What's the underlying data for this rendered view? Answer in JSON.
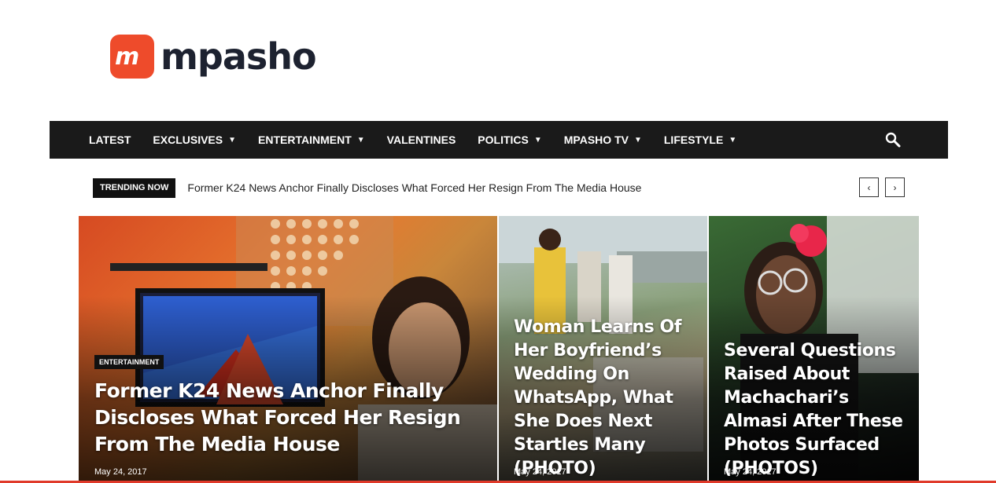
{
  "brand": {
    "logo_mark": "m",
    "name": "mpasho",
    "accent": "#ee4b2b"
  },
  "nav": {
    "items": [
      {
        "label": "LATEST",
        "dropdown": false
      },
      {
        "label": "EXCLUSIVES",
        "dropdown": true
      },
      {
        "label": "ENTERTAINMENT",
        "dropdown": true
      },
      {
        "label": "VALENTINES",
        "dropdown": false
      },
      {
        "label": "POLITICS",
        "dropdown": true
      },
      {
        "label": "MPASHO TV",
        "dropdown": true
      },
      {
        "label": "LIFESTYLE",
        "dropdown": true
      }
    ],
    "search_icon": "search-icon",
    "chevron": "⌄"
  },
  "trending": {
    "label": "TRENDING NOW",
    "headline": "Former K24 News Anchor Finally Discloses What Forced Her Resign From The Media House",
    "prev": "‹",
    "next": "›"
  },
  "featured": [
    {
      "category": "ENTERTAINMENT",
      "title": "Former K24 News Anchor Finally Discloses What Forced Her Resign From The Media House",
      "date": "May 24, 2017"
    },
    {
      "title": "Woman Learns Of Her Boyfriend’s Wedding On WhatsApp, What She Does Next Startles Many (PHOTO)",
      "date": "May 24, 2017"
    },
    {
      "title": "Several Questions Raised About Machachari’s Almasi After These Photos Surfaced (PHOTOS)",
      "date": "May 24, 2017"
    }
  ]
}
